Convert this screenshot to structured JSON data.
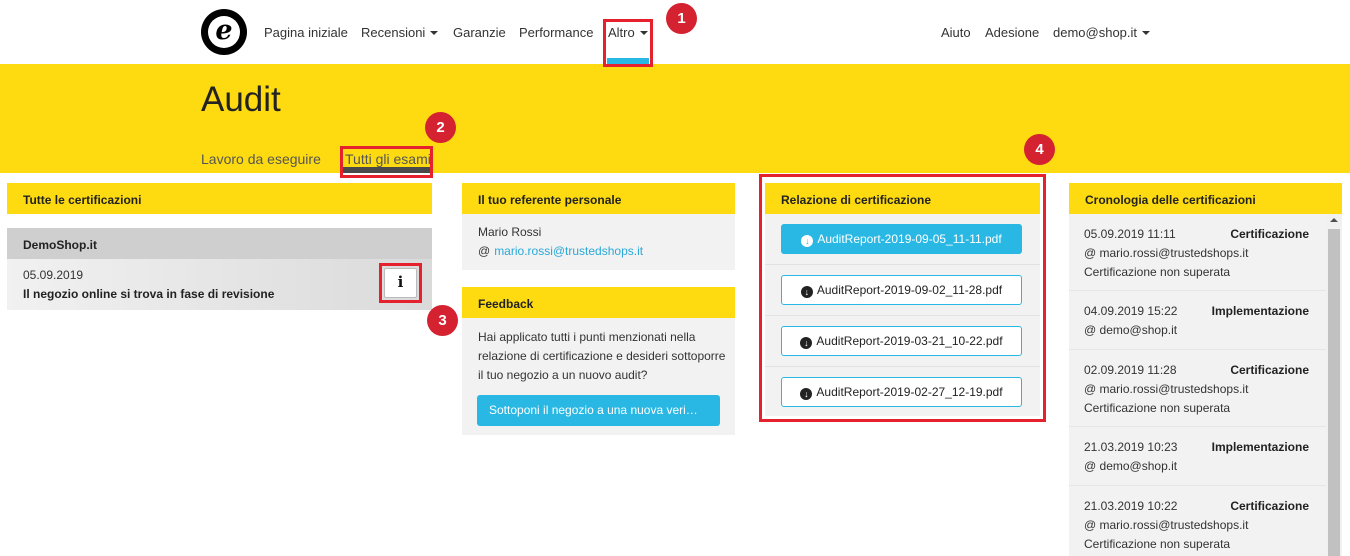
{
  "nav": {
    "left": [
      {
        "label": "Pagina iniziale",
        "caret": false
      },
      {
        "label": "Recensioni",
        "caret": true
      },
      {
        "label": "Garanzie",
        "caret": false
      },
      {
        "label": "Performance",
        "caret": false
      },
      {
        "label": "Altro",
        "caret": true,
        "active": true
      }
    ],
    "right": [
      {
        "label": "Aiuto"
      },
      {
        "label": "Adesione"
      },
      {
        "label": "demo@shop.it",
        "caret": true
      }
    ],
    "logo_letter": "e"
  },
  "header": {
    "title": "Audit",
    "tabs": [
      {
        "label": "Lavoro da eseguire",
        "active": false
      },
      {
        "label": "Tutti gli esami",
        "active": true
      }
    ]
  },
  "markers": [
    "1",
    "2",
    "3",
    "4"
  ],
  "certifications": {
    "title": "Tutte le certificazioni",
    "shop_name": "DemoShop.it",
    "date": "05.09.2019",
    "status": "Il negozio online si trova in fase di revisione",
    "info_label": "i"
  },
  "referent": {
    "title": "Il tuo referente personale",
    "name": "Mario Rossi",
    "email_prefix": "@",
    "email": "mario.rossi@trustedshops.it"
  },
  "feedback": {
    "title": "Feedback",
    "text": "Hai applicato tutti i punti menzionati nella relazione di certificazione e desideri sottoporre il tuo negozio a un nuovo audit?",
    "button": "Sottoponi il negozio a una nuova veri…"
  },
  "reports": {
    "title": "Relazione di certificazione",
    "files": [
      "AuditReport-2019-09-05_11-11.pdf",
      "AuditReport-2019-09-02_11-28.pdf",
      "AuditReport-2019-03-21_10-22.pdf",
      "AuditReport-2019-02-27_12-19.pdf"
    ]
  },
  "history": {
    "title": "Cronologia delle certificazioni",
    "items": [
      {
        "date": "05.09.2019 11:11",
        "type": "Certificazione",
        "user": "@ mario.rossi@trustedshops.it",
        "result": "Certificazione non superata"
      },
      {
        "date": "04.09.2019 15:22",
        "type": "Implementazione",
        "user": "@ demo@shop.it",
        "result": ""
      },
      {
        "date": "02.09.2019 11:28",
        "type": "Certificazione",
        "user": "@ mario.rossi@trustedshops.it",
        "result": "Certificazione non superata"
      },
      {
        "date": "21.03.2019 10:23",
        "type": "Implementazione",
        "user": "@ demo@shop.it",
        "result": ""
      },
      {
        "date": "21.03.2019 10:22",
        "type": "Certificazione",
        "user": "@ mario.rossi@trustedshops.it",
        "result": "Certificazione non superata"
      }
    ]
  },
  "colors": {
    "brand_yellow": "#fddb10",
    "accent_blue": "#29b8e3",
    "marker_red": "#d42231"
  }
}
